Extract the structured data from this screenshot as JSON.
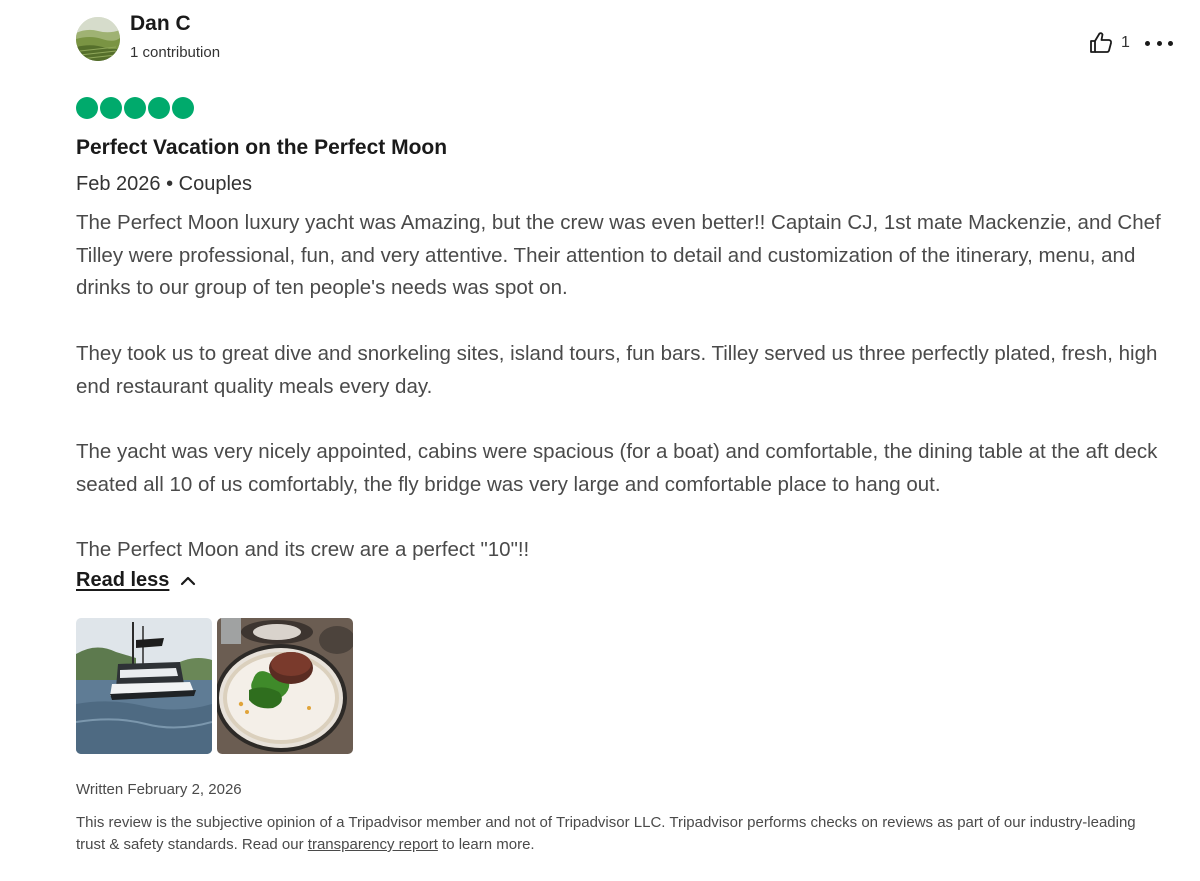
{
  "author": {
    "name": "Dan C",
    "contributions": "1 contribution"
  },
  "actions": {
    "helpful_count": "1"
  },
  "rating": {
    "value": 5,
    "max": 5,
    "color": "#00aa6c"
  },
  "review": {
    "title": "Perfect Vacation on the Perfect Moon",
    "date": "Feb 2026",
    "separator": " • ",
    "trip_type": "Couples",
    "paragraphs": [
      "The Perfect Moon luxury yacht was Amazing, but the crew was even better!! Captain CJ, 1st mate Mackenzie, and Chef Tilley were professional, fun, and very attentive. Their attention to detail and customization of the itinerary, menu, and drinks to our group of ten people's needs was spot on.",
      "They took us to great dive and snorkeling sites, island tours, fun bars. Tilley served us three perfectly plated, fresh, high end restaurant quality meals every day.",
      "The yacht was very nicely appointed, cabins were spacious (for a boat) and comfortable, the dining table at the aft deck seated all 10 of us comfortably, the fly bridge was very large and comfortable place to hang out.",
      "The Perfect Moon and its crew are a perfect \"10\"!!"
    ],
    "read_less": "Read less"
  },
  "written": "Written February 2, 2026",
  "disclaimer": {
    "before_link": "This review is the subjective opinion of a Tripadvisor member and not of Tripadvisor LLC. Tripadvisor performs checks on reviews as part of our industry-leading trust & safety standards. Read our ",
    "link": "transparency report",
    "after_link": " to learn more."
  }
}
